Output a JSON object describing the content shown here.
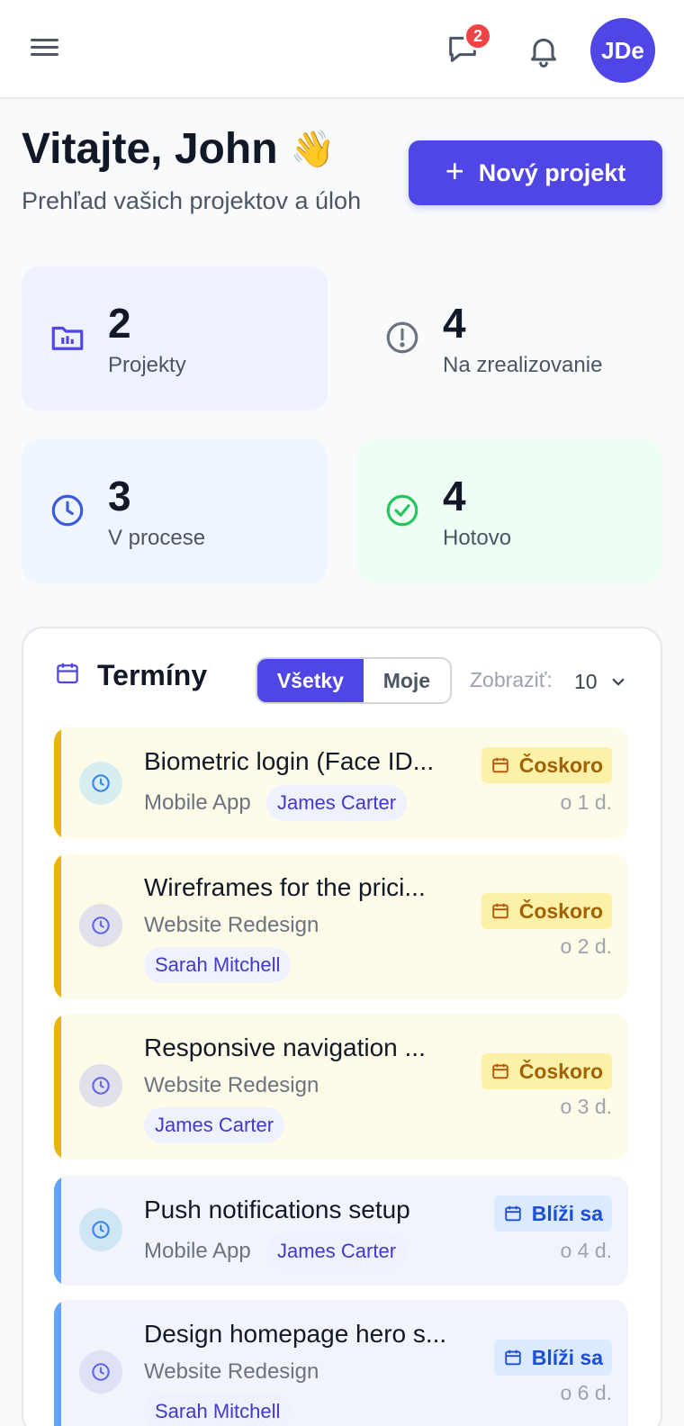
{
  "header": {
    "messages_badge": "2",
    "avatar_initials": "JDe"
  },
  "welcome": {
    "title": "Vitajte, John",
    "emoji": "👋",
    "subtitle": "Prehľad vašich projektov a úloh",
    "new_project_label": "Nový projekt"
  },
  "stats": [
    {
      "value": "2",
      "label": "Projekty"
    },
    {
      "value": "4",
      "label": "Na zrealizovanie"
    },
    {
      "value": "3",
      "label": "V procese"
    },
    {
      "value": "4",
      "label": "Hotovo"
    }
  ],
  "deadlines": {
    "title": "Termíny",
    "filter_all": "Všetky",
    "filter_mine": "Moje",
    "show_label": "Zobraziť:",
    "show_value": "10",
    "items": [
      {
        "task": "Biometric login (Face ID...",
        "project": "Mobile App",
        "assignee": "James Carter",
        "status": "Čoskoro",
        "due": "o 1 d."
      },
      {
        "task": "Wireframes for the prici...",
        "project": "Website Redesign",
        "assignee": "Sarah Mitchell",
        "status": "Čoskoro",
        "due": "o 2 d."
      },
      {
        "task": "Responsive navigation ...",
        "project": "Website Redesign",
        "assignee": "James Carter",
        "status": "Čoskoro",
        "due": "o 3 d."
      },
      {
        "task": "Push notifications setup",
        "project": "Mobile App",
        "assignee": "James Carter",
        "status": "Blíži sa",
        "due": "o 4 d."
      },
      {
        "task": "Design homepage hero s...",
        "project": "Website Redesign",
        "assignee": "Sarah Mitchell",
        "status": "Blíži sa",
        "due": "o 6 d."
      }
    ]
  },
  "colors": {
    "primary": "#4f46e5",
    "soon_bar": "#eab308",
    "near_bar": "#60a5fa",
    "done_green": "#22c55e"
  }
}
